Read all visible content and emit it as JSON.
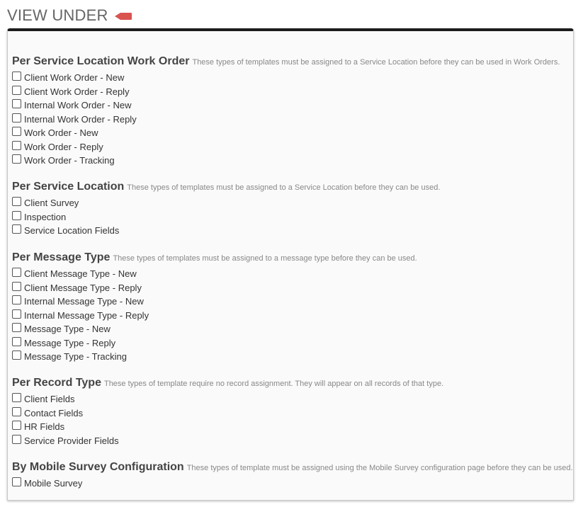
{
  "header": {
    "title": "VIEW UNDER",
    "tag_icon": "red-tag-arrow-icon",
    "tag_color": "#d9534f"
  },
  "sections": [
    {
      "title": "Per Service Location Work Order",
      "description": "These types of templates must be assigned to a Service Location before they can be used in Work Orders.",
      "options": [
        "Client Work Order - New",
        "Client Work Order - Reply",
        "Internal Work Order - New",
        "Internal Work Order - Reply",
        "Work Order - New",
        "Work Order - Reply",
        "Work Order - Tracking"
      ]
    },
    {
      "title": "Per Service Location",
      "description": "These types of templates must be assigned to a Service Location before they can be used.",
      "options": [
        "Client Survey",
        "Inspection",
        "Service Location Fields"
      ]
    },
    {
      "title": "Per Message Type",
      "description": "These types of templates must be assigned to a message type before they can be used.",
      "options": [
        "Client Message Type - New",
        "Client Message Type - Reply",
        "Internal Message Type - New",
        "Internal Message Type - Reply",
        "Message Type - New",
        "Message Type - Reply",
        "Message Type - Tracking"
      ]
    },
    {
      "title": "Per Record Type",
      "description": "These types of template require no record assignment. They will appear on all records of that type.",
      "options": [
        "Client Fields",
        "Contact Fields",
        "HR Fields",
        "Service Provider Fields"
      ]
    },
    {
      "title": "By Mobile Survey Configuration",
      "description": "These types of template must be assigned using the Mobile Survey configuration page before they can be used.",
      "options": [
        "Mobile Survey"
      ]
    }
  ]
}
